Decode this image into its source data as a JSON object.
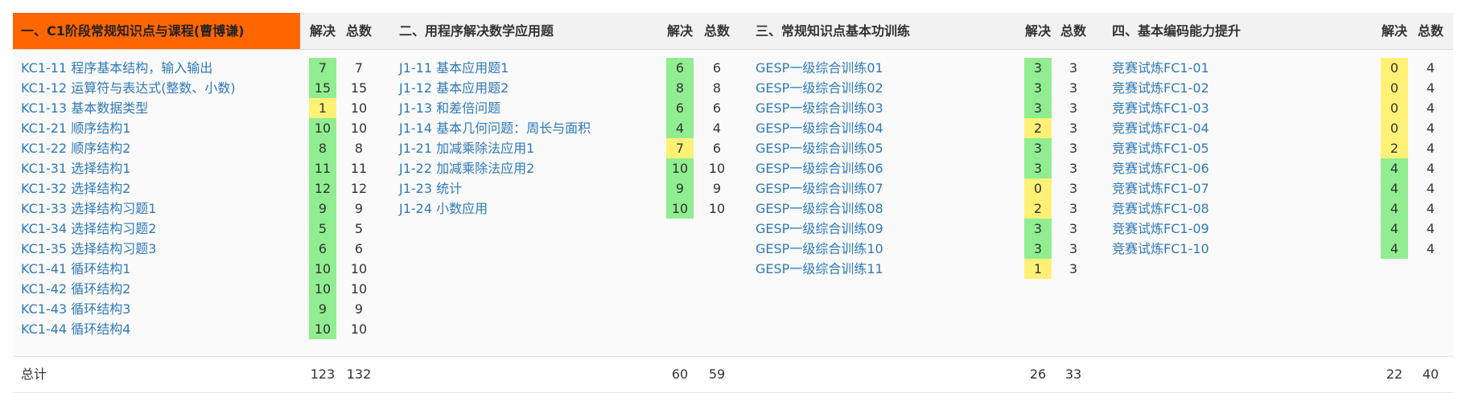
{
  "footer_label": "总计",
  "colors": {
    "full": "#90ee90",
    "partial": "#fff176",
    "header_accent": "#ff6600",
    "link": "#2f7ab8"
  },
  "sections": [
    {
      "title": "一、C1阶段常规知识点与课程(曹博谦)",
      "solved_header": "解决",
      "total_header": "总数",
      "items": [
        {
          "name": "KC1-11 程序基本结构，输入输出",
          "solved": "7",
          "total": "7",
          "status": "full"
        },
        {
          "name": "KC1-12 运算符与表达式(整数、小数)",
          "solved": "15",
          "total": "15",
          "status": "full"
        },
        {
          "name": "KC1-13 基本数据类型",
          "solved": "1",
          "total": "10",
          "status": "partial"
        },
        {
          "name": "KC1-21 顺序结构1",
          "solved": "10",
          "total": "10",
          "status": "full"
        },
        {
          "name": "KC1-22 顺序结构2",
          "solved": "8",
          "total": "8",
          "status": "full"
        },
        {
          "name": "KC1-31 选择结构1",
          "solved": "11",
          "total": "11",
          "status": "full"
        },
        {
          "name": "KC1-32 选择结构2",
          "solved": "12",
          "total": "12",
          "status": "full"
        },
        {
          "name": "KC1-33 选择结构习题1",
          "solved": "9",
          "total": "9",
          "status": "full"
        },
        {
          "name": "KC1-34 选择结构习题2",
          "solved": "5",
          "total": "5",
          "status": "full"
        },
        {
          "name": "KC1-35 选择结构习题3",
          "solved": "6",
          "total": "6",
          "status": "full"
        },
        {
          "name": "KC1-41 循环结构1",
          "solved": "10",
          "total": "10",
          "status": "full"
        },
        {
          "name": "KC1-42 循环结构2",
          "solved": "10",
          "total": "10",
          "status": "full"
        },
        {
          "name": "KC1-43 循环结构3",
          "solved": "9",
          "total": "9",
          "status": "full"
        },
        {
          "name": "KC1-44 循环结构4",
          "solved": "10",
          "total": "10",
          "status": "full"
        }
      ],
      "sum_solved": "123",
      "sum_total": "132"
    },
    {
      "title": "二、用程序解决数学应用题",
      "solved_header": "解决",
      "total_header": "总数",
      "items": [
        {
          "name": "J1-11 基本应用题1",
          "solved": "6",
          "total": "6",
          "status": "full"
        },
        {
          "name": "J1-12 基本应用题2",
          "solved": "8",
          "total": "8",
          "status": "full"
        },
        {
          "name": "J1-13 和差倍问题",
          "solved": "6",
          "total": "6",
          "status": "full"
        },
        {
          "name": "J1-14 基本几何问题：周长与面积",
          "solved": "4",
          "total": "4",
          "status": "full"
        },
        {
          "name": "J1-21 加减乘除法应用1",
          "solved": "7",
          "total": "6",
          "status": "partial"
        },
        {
          "name": "J1-22 加减乘除法应用2",
          "solved": "10",
          "total": "10",
          "status": "full"
        },
        {
          "name": "J1-23 统计",
          "solved": "9",
          "total": "9",
          "status": "full"
        },
        {
          "name": "J1-24 小数应用",
          "solved": "10",
          "total": "10",
          "status": "full"
        }
      ],
      "sum_solved": "60",
      "sum_total": "59"
    },
    {
      "title": "三、常规知识点基本功训练",
      "solved_header": "解决",
      "total_header": "总数",
      "items": [
        {
          "name": "GESP一级综合训练01",
          "solved": "3",
          "total": "3",
          "status": "full"
        },
        {
          "name": "GESP一级综合训练02",
          "solved": "3",
          "total": "3",
          "status": "full"
        },
        {
          "name": "GESP一级综合训练03",
          "solved": "3",
          "total": "3",
          "status": "full"
        },
        {
          "name": "GESP一级综合训练04",
          "solved": "2",
          "total": "3",
          "status": "partial"
        },
        {
          "name": "GESP一级综合训练05",
          "solved": "3",
          "total": "3",
          "status": "full"
        },
        {
          "name": "GESP一级综合训练06",
          "solved": "3",
          "total": "3",
          "status": "full"
        },
        {
          "name": "GESP一级综合训练07",
          "solved": "0",
          "total": "3",
          "status": "partial"
        },
        {
          "name": "GESP一级综合训练08",
          "solved": "2",
          "total": "3",
          "status": "partial"
        },
        {
          "name": "GESP一级综合训练09",
          "solved": "3",
          "total": "3",
          "status": "full"
        },
        {
          "name": "GESP一级综合训练10",
          "solved": "3",
          "total": "3",
          "status": "full"
        },
        {
          "name": "GESP一级综合训练11",
          "solved": "1",
          "total": "3",
          "status": "partial"
        }
      ],
      "sum_solved": "26",
      "sum_total": "33"
    },
    {
      "title": "四、基本编码能力提升",
      "solved_header": "解决",
      "total_header": "总数",
      "items": [
        {
          "name": "竞赛试炼FC1-01",
          "solved": "0",
          "total": "4",
          "status": "partial"
        },
        {
          "name": "竞赛试炼FC1-02",
          "solved": "0",
          "total": "4",
          "status": "partial"
        },
        {
          "name": "竞赛试炼FC1-03",
          "solved": "0",
          "total": "4",
          "status": "partial"
        },
        {
          "name": "竞赛试炼FC1-04",
          "solved": "0",
          "total": "4",
          "status": "partial"
        },
        {
          "name": "竞赛试炼FC1-05",
          "solved": "2",
          "total": "4",
          "status": "partial"
        },
        {
          "name": "竞赛试炼FC1-06",
          "solved": "4",
          "total": "4",
          "status": "full"
        },
        {
          "name": "竞赛试炼FC1-07",
          "solved": "4",
          "total": "4",
          "status": "full"
        },
        {
          "name": "竞赛试炼FC1-08",
          "solved": "4",
          "total": "4",
          "status": "full"
        },
        {
          "name": "竞赛试炼FC1-09",
          "solved": "4",
          "total": "4",
          "status": "full"
        },
        {
          "name": "竞赛试炼FC1-10",
          "solved": "4",
          "total": "4",
          "status": "full"
        }
      ],
      "sum_solved": "22",
      "sum_total": "40"
    }
  ]
}
